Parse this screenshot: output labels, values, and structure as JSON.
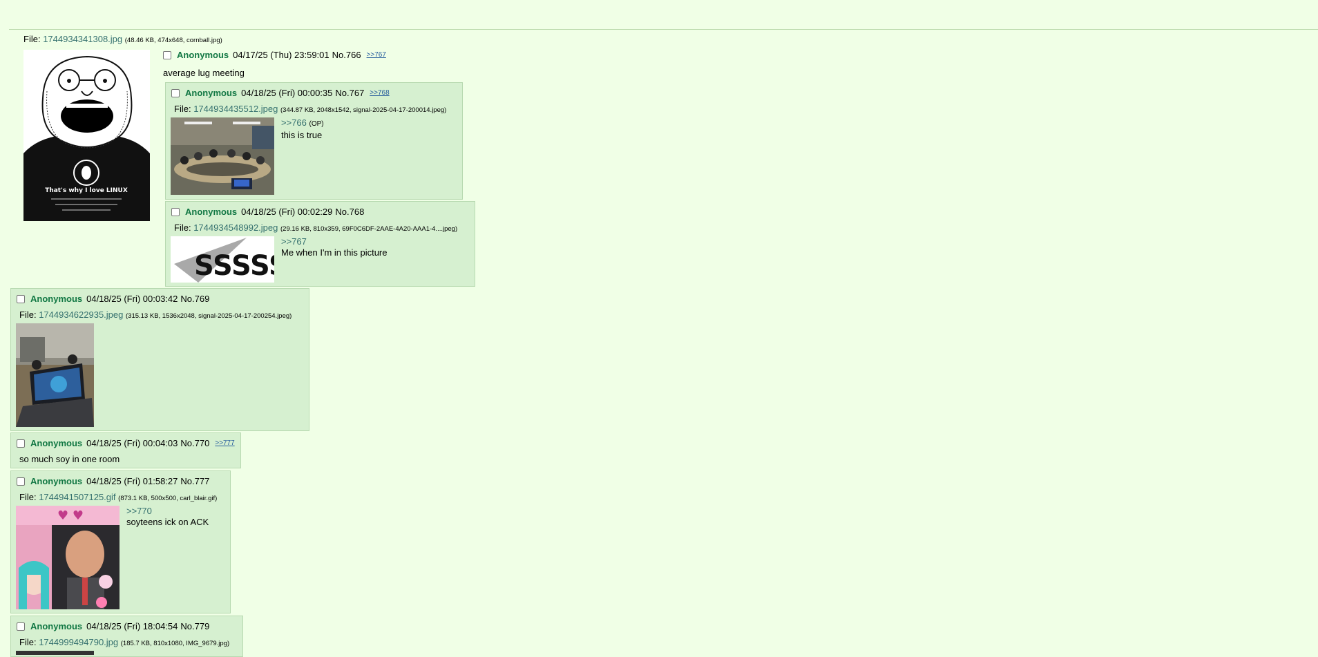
{
  "op": {
    "file_label": "File:",
    "file_link": "1744934341308.jpg",
    "file_meta": "(48.46 KB, 474x648, cornball.jpg)",
    "name": "Anonymous",
    "datetime": "04/17/25 (Thu) 23:59:01",
    "no": "No.766",
    "backlinks": ">>767",
    "message": "average lug meeting",
    "shirt_text": "That's why I love LINUX"
  },
  "replies": [
    {
      "name": "Anonymous",
      "datetime": "04/18/25 (Fri) 00:00:35",
      "no": "No.767",
      "backlinks": ">>768",
      "file_label": "File:",
      "file_link": "1744934435512.jpeg",
      "file_meta": "(344.87 KB, 2048x1542, signal-2025-04-17-200014.jpeg)",
      "quote": ">>766",
      "op_mark": "(OP)",
      "message": "this is true"
    },
    {
      "name": "Anonymous",
      "datetime": "04/18/25 (Fri) 00:02:29",
      "no": "No.768",
      "backlinks": "",
      "file_label": "File:",
      "file_link": "1744934548992.jpeg",
      "file_meta": "(29.16 KB, 810x359, 69F0C6DF-2AAE-4A20-AAA1-4....jpeg)",
      "quote": ">>767",
      "message": "Me when I'm in this picture",
      "thumb_text": "SSSSS"
    },
    {
      "name": "Anonymous",
      "datetime": "04/18/25 (Fri) 00:03:42",
      "no": "No.769",
      "backlinks": "",
      "file_label": "File:",
      "file_link": "1744934622935.jpeg",
      "file_meta": "(315.13 KB, 1536x2048, signal-2025-04-17-200254.jpeg)"
    },
    {
      "name": "Anonymous",
      "datetime": "04/18/25 (Fri) 00:04:03",
      "no": "No.770",
      "backlinks": ">>777",
      "message": "so much soy in one room"
    },
    {
      "name": "Anonymous",
      "datetime": "04/18/25 (Fri) 01:58:27",
      "no": "No.777",
      "backlinks": "",
      "file_label": "File:",
      "file_link": "1744941507125.gif",
      "file_meta": "(873.1 KB, 500x500, carl_blair.gif)",
      "quote": ">>770",
      "message": "soyteens ick on ACK"
    },
    {
      "name": "Anonymous",
      "datetime": "04/18/25 (Fri) 18:04:54",
      "no": "No.779",
      "backlinks": "",
      "file_label": "File:",
      "file_link": "1744999494790.jpg",
      "file_meta": "(185.7 KB, 810x1080, IMG_9679.jpg)"
    }
  ]
}
